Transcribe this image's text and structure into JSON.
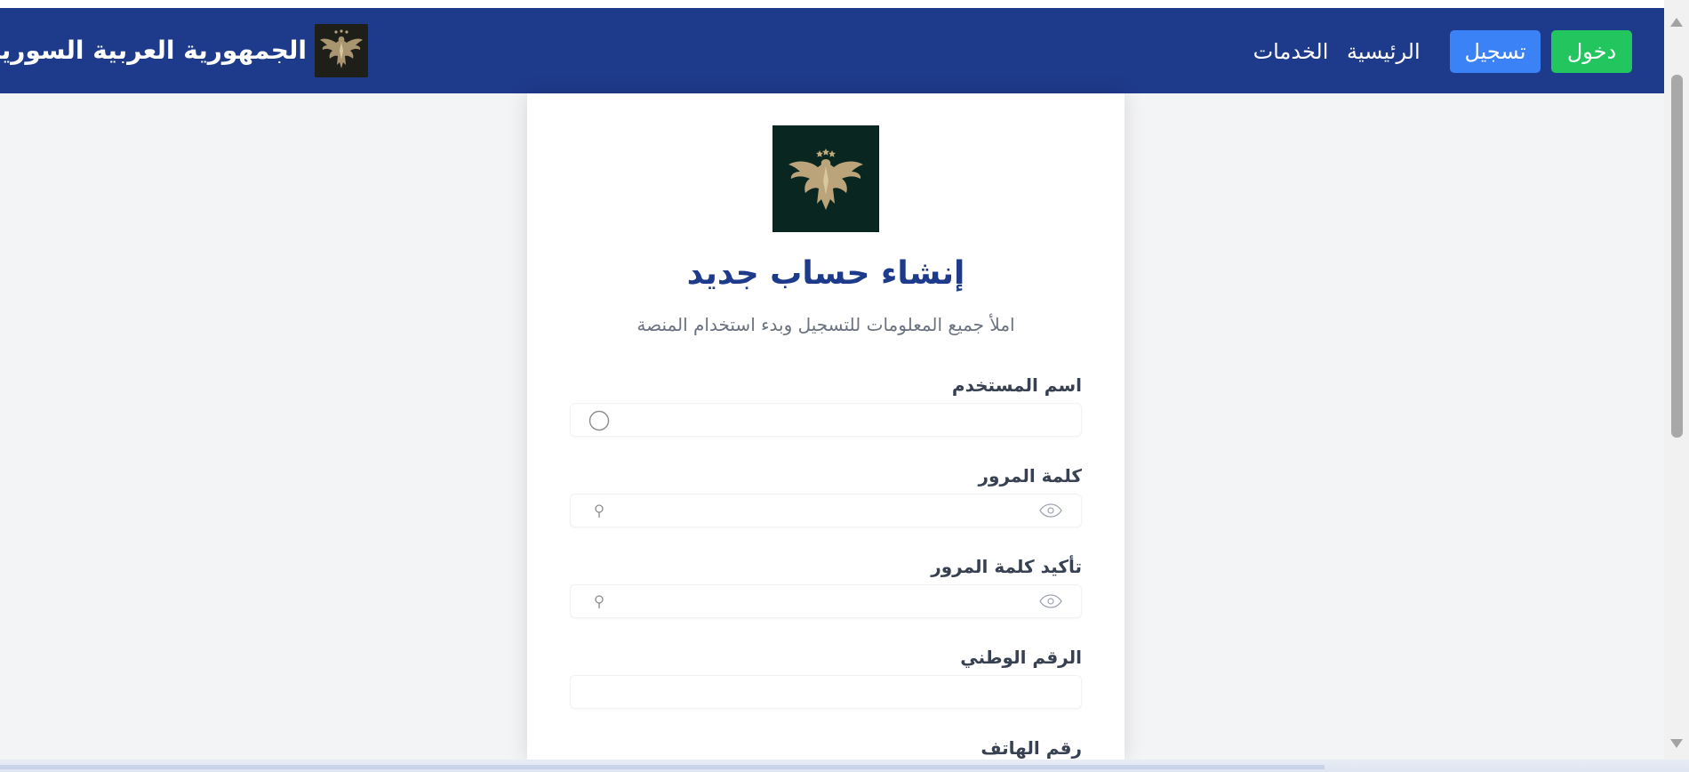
{
  "header": {
    "brand_title": "الجمهورية العربية السورية",
    "brand_logo_icon": "eagle-emblem-icon",
    "nav_links": {
      "home": "الرئيسية",
      "services": "الخدمات"
    },
    "register_label": "تسجيل",
    "login_label": "دخول",
    "colors": {
      "header_bg": "#1e3a8a",
      "register_bg": "#3b82f6",
      "login_bg": "#22c55e"
    }
  },
  "form": {
    "logo_icon": "eagle-emblem-icon",
    "title": "إنشاء حساب جديد",
    "subtitle": "املأ جميع المعلومات للتسجيل وبدء استخدام المنصة",
    "fields": {
      "username": {
        "label": "اسم المستخدم",
        "value": "",
        "icon": "user-status-circle-icon"
      },
      "password": {
        "label": "كلمة المرور",
        "value": "",
        "icons": [
          "eye-icon",
          "key-icon"
        ]
      },
      "confirm_password": {
        "label": "تأكيد كلمة المرور",
        "value": "",
        "icons": [
          "eye-icon",
          "key-icon"
        ]
      },
      "national_id": {
        "label": "الرقم الوطني",
        "value": ""
      },
      "phone": {
        "label": "رقم الهاتف",
        "value": ""
      }
    }
  }
}
